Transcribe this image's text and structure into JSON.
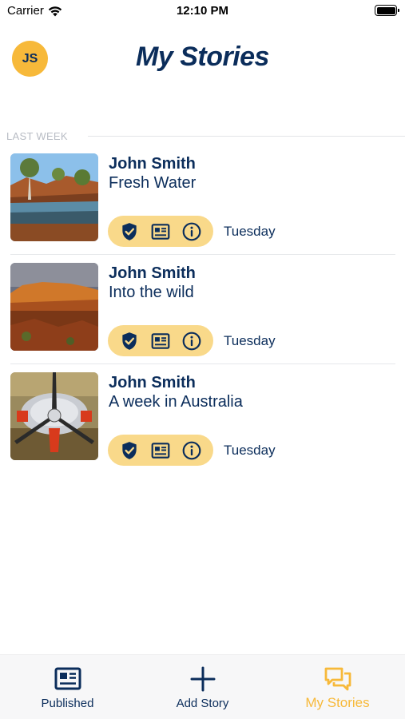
{
  "status_bar": {
    "carrier": "Carrier",
    "time": "12:10 PM"
  },
  "header": {
    "avatar_initials": "JS",
    "title": "My Stories"
  },
  "section": {
    "label": "LAST WEEK"
  },
  "stories": [
    {
      "author": "John Smith",
      "title": "Fresh Water",
      "date": "Tuesday",
      "thumbnail": "river-gorge-photo"
    },
    {
      "author": "John Smith",
      "title": "Into the wild",
      "date": "Tuesday",
      "thumbnail": "red-rock-range-photo"
    },
    {
      "author": "John Smith",
      "title": "A week in Australia",
      "date": "Tuesday",
      "thumbnail": "aircraft-propeller-photo"
    }
  ],
  "story_actions": [
    "shield-check-icon",
    "newspaper-icon",
    "info-icon"
  ],
  "tab_bar": {
    "tabs": [
      {
        "label": "Published",
        "icon": "newspaper-icon",
        "active": false
      },
      {
        "label": "Add Story",
        "icon": "plus-icon",
        "active": false
      },
      {
        "label": "My Stories",
        "icon": "chat-bubbles-icon",
        "active": true
      }
    ]
  },
  "colors": {
    "navy": "#0b2d5b",
    "accent": "#f7b93a",
    "pill": "#f9d98a",
    "section_label": "#b8bcc4"
  }
}
